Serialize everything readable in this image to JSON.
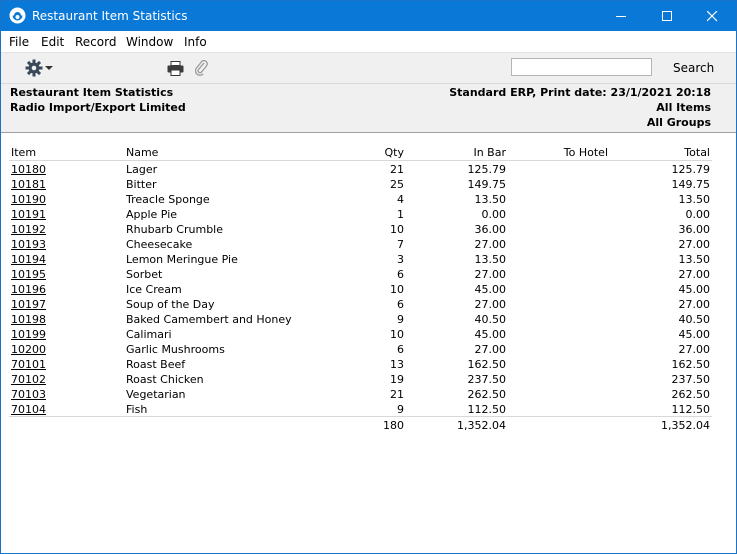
{
  "window": {
    "title": "Restaurant Item Statistics",
    "accent_color": "#0a78d7"
  },
  "menu": [
    "File",
    "Edit",
    "Record",
    "Window",
    "Info"
  ],
  "toolbar": {
    "gear_icon": "gear-icon",
    "print_icon": "printer-icon",
    "attach_icon": "paperclip-icon",
    "search_value": "",
    "search_label": "Search"
  },
  "header": {
    "report_name": "Restaurant Item Statistics",
    "company": "Radio Import/Export Limited",
    "system_print": "Standard ERP, Print date: 23/1/2021 20:18",
    "items_filter": "All Items",
    "groups_filter": "All Groups"
  },
  "table": {
    "columns": {
      "item": "Item",
      "name": "Name",
      "qty": "Qty",
      "in_bar": "In Bar",
      "to_hotel": "To Hotel",
      "total": "Total"
    },
    "rows": [
      {
        "item": "10180",
        "name": "Lager",
        "qty": "21",
        "in_bar": "125.79",
        "to_hotel": "",
        "total": "125.79"
      },
      {
        "item": "10181",
        "name": "Bitter",
        "qty": "25",
        "in_bar": "149.75",
        "to_hotel": "",
        "total": "149.75"
      },
      {
        "item": "10190",
        "name": "Treacle Sponge",
        "qty": "4",
        "in_bar": "13.50",
        "to_hotel": "",
        "total": "13.50"
      },
      {
        "item": "10191",
        "name": "Apple Pie",
        "qty": "1",
        "in_bar": "0.00",
        "to_hotel": "",
        "total": "0.00"
      },
      {
        "item": "10192",
        "name": "Rhubarb Crumble",
        "qty": "10",
        "in_bar": "36.00",
        "to_hotel": "",
        "total": "36.00"
      },
      {
        "item": "10193",
        "name": "Cheesecake",
        "qty": "7",
        "in_bar": "27.00",
        "to_hotel": "",
        "total": "27.00"
      },
      {
        "item": "10194",
        "name": "Lemon Meringue Pie",
        "qty": "3",
        "in_bar": "13.50",
        "to_hotel": "",
        "total": "13.50"
      },
      {
        "item": "10195",
        "name": "Sorbet",
        "qty": "6",
        "in_bar": "27.00",
        "to_hotel": "",
        "total": "27.00"
      },
      {
        "item": "10196",
        "name": "Ice Cream",
        "qty": "10",
        "in_bar": "45.00",
        "to_hotel": "",
        "total": "45.00"
      },
      {
        "item": "10197",
        "name": "Soup of the Day",
        "qty": "6",
        "in_bar": "27.00",
        "to_hotel": "",
        "total": "27.00"
      },
      {
        "item": "10198",
        "name": "Baked Camembert and Honey",
        "qty": "9",
        "in_bar": "40.50",
        "to_hotel": "",
        "total": "40.50"
      },
      {
        "item": "10199",
        "name": "Calimari",
        "qty": "10",
        "in_bar": "45.00",
        "to_hotel": "",
        "total": "45.00"
      },
      {
        "item": "10200",
        "name": "Garlic Mushrooms",
        "qty": "6",
        "in_bar": "27.00",
        "to_hotel": "",
        "total": "27.00"
      },
      {
        "item": "70101",
        "name": "Roast Beef",
        "qty": "13",
        "in_bar": "162.50",
        "to_hotel": "",
        "total": "162.50"
      },
      {
        "item": "70102",
        "name": "Roast Chicken",
        "qty": "19",
        "in_bar": "237.50",
        "to_hotel": "",
        "total": "237.50"
      },
      {
        "item": "70103",
        "name": "Vegetarian",
        "qty": "21",
        "in_bar": "262.50",
        "to_hotel": "",
        "total": "262.50"
      },
      {
        "item": "70104",
        "name": "Fish",
        "qty": "9",
        "in_bar": "112.50",
        "to_hotel": "",
        "total": "112.50"
      }
    ],
    "totals": {
      "qty": "180",
      "in_bar": "1,352.04",
      "to_hotel": "",
      "total": "1,352.04"
    }
  }
}
